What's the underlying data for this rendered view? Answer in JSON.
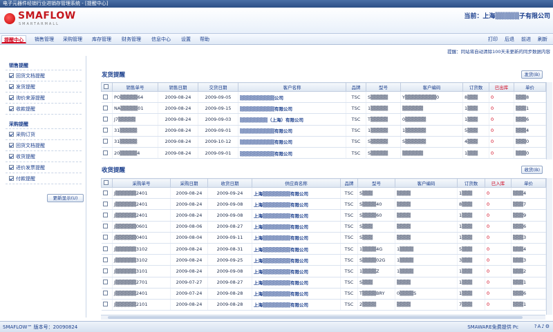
{
  "window": {
    "title": "电子元器件经销行业进销存管理系统 - [提醒中心]"
  },
  "header": {
    "logo_text": "SMAFLOW",
    "logo_sub": "SMARTARMALL",
    "company": "当前：上海▒▒▒▒▒子有限公司"
  },
  "menu": {
    "items": [
      "提醒中心",
      "销售管理",
      "采购管理",
      "库存管理",
      "财务管理",
      "信息中心",
      "设置",
      "帮助"
    ],
    "toolbar": [
      "打印",
      "后退",
      "前进",
      "刷新"
    ]
  },
  "notice": "提醒：同站将自动清除100天未更新的同步数据内容",
  "sidebar": {
    "sales_group": "销售提醒",
    "sales_items": [
      "回货文档提醒",
      "发货提醒",
      "询价来源提醒",
      "收款提醒"
    ],
    "purchase_group": "采购提醒",
    "purchase_items": [
      "采购订货",
      "回货文档提醒",
      "收货提醒",
      "进价发票提醒",
      "付款提醒"
    ],
    "more_button": "更新显示(U)"
  },
  "ship": {
    "title": "发货提醒",
    "button": "发货(B)",
    "headers": [
      "",
      "销售单号",
      "销售日期",
      "交货日期",
      "客户名称",
      "品牌",
      "型号",
      "客户编码",
      "订货数",
      "已出库",
      "单价"
    ],
    "rows": [
      [
        "",
        "PO▒▒▒▒▒64",
        "2009-08-24",
        "2009-09-05",
        "▒▒▒▒▒▒▒▒▒▒公司",
        "TSC",
        "S▒▒▒▒▒",
        "Y▒▒▒▒▒▒▒▒▒0",
        "8▒▒▒",
        "0",
        "▒▒▒8"
      ],
      [
        "",
        "NA▒▒▒▒▒01",
        "2009-08-24",
        "2009-09-15",
        "▒▒▒▒▒▒▒▒▒▒有限公司",
        "TSC",
        "1▒▒▒▒▒",
        "▒▒▒▒▒▒",
        "1▒▒▒",
        "0",
        "▒▒▒1"
      ],
      [
        "",
        "J7▒▒▒▒▒",
        "2009-08-24",
        "2009-09-03",
        "▒▒▒▒▒▒▒▒（上海）有限公司",
        "TSC",
        "T▒▒▒▒▒",
        "0▒▒▒▒▒▒",
        "1▒▒▒",
        "0",
        "▒▒▒6"
      ],
      [
        "",
        "31▒▒▒▒▒",
        "2009-08-24",
        "2009-09-01",
        "▒▒▒▒▒▒▒▒▒▒有限公司",
        "TSC",
        "1▒▒▒▒▒",
        "1▒▒▒▒▒▒",
        "5▒▒▒",
        "0",
        "▒▒▒4"
      ],
      [
        "",
        "31▒▒▒▒▒",
        "2009-08-24",
        "2009-10-12",
        "▒▒▒▒▒▒▒▒▒▒有限公司",
        "TSC",
        "S▒▒▒▒▒",
        "S▒▒▒▒▒▒",
        "4▒▒▒",
        "0",
        "▒▒▒0"
      ],
      [
        "",
        "20▒▒▒▒▒4",
        "2009-08-24",
        "2009-09-01",
        "▒▒▒▒▒▒▒▒▒▒有限公司",
        "TSC",
        "S▒▒▒▒▒",
        "▒▒▒▒▒▒",
        "1▒▒▒",
        "0",
        "▒▒▒0"
      ]
    ]
  },
  "receive": {
    "title": "收货提醒",
    "button": "收货(B)",
    "headers": [
      "",
      "采购单号",
      "采购日期",
      "收货日期",
      "供应商名称",
      "品牌",
      "型号",
      "客户编码",
      "订货数",
      "已入库",
      "单价"
    ],
    "rows": [
      [
        "",
        "J▒▒▒▒▒▒2401",
        "2009-08-24",
        "2009-09-24",
        "上海▒▒▒▒▒▒▒▒有限公司",
        "TSC",
        "S▒▒▒",
        "▒▒▒▒",
        "1▒▒▒",
        "0",
        "▒▒▒4"
      ],
      [
        "",
        "J▒▒▒▒▒▒2401",
        "2009-08-24",
        "2009-09-08",
        "上海▒▒▒▒▒▒▒▒有限公司",
        "TSC",
        "S▒▒▒▒40",
        "▒▒▒▒",
        "8▒▒▒",
        "0",
        "▒▒▒7"
      ],
      [
        "",
        "J▒▒▒▒▒▒2401",
        "2009-08-24",
        "2009-09-08",
        "上海▒▒▒▒▒▒▒▒有限公司",
        "TSC",
        "S▒▒▒▒60",
        "▒▒▒▒",
        "1▒▒▒",
        "0",
        "▒▒▒9"
      ],
      [
        "",
        "J▒▒▒▒▒▒0601",
        "2009-08-06",
        "2009-08-27",
        "上海▒▒▒▒▒▒▒▒有限公司",
        "TSC",
        "S▒▒▒",
        "▒▒▒▒",
        "1▒▒▒",
        "0",
        "▒▒▒6"
      ],
      [
        "",
        "J▒▒▒▒▒▒0401",
        "2009-08-04",
        "2009-09-11",
        "上海▒▒▒▒▒▒▒▒有限公司",
        "TSC",
        "S▒▒▒",
        "▒▒▒▒",
        "1▒▒▒",
        "0",
        "▒▒▒3"
      ],
      [
        "",
        "J▒▒▒▒▒▒3102",
        "2009-08-24",
        "2009-08-31",
        "上海▒▒▒▒▒▒▒▒有限公司",
        "TSC",
        "1▒▒▒▒4G",
        "1▒▒▒▒",
        "5▒▒▒",
        "0",
        "▒▒▒4"
      ],
      [
        "",
        "J▒▒▒▒▒▒3102",
        "2009-08-24",
        "2009-09-25",
        "上海▒▒▒▒▒▒▒▒有限公司",
        "TSC",
        "S▒▒▒▒02G",
        "1▒▒▒▒",
        "3▒▒▒",
        "0",
        "▒▒▒3"
      ],
      [
        "",
        "J▒▒▒▒▒▒3101",
        "2009-08-24",
        "2009-09-08",
        "上海▒▒▒▒▒▒▒▒有限公司",
        "TSC",
        "1▒▒▒▒Z",
        "1▒▒▒▒",
        "1▒▒▒",
        "0",
        "▒▒▒2"
      ],
      [
        "",
        "J▒▒▒▒▒▒2701",
        "2009-07-27",
        "2009-08-27",
        "上海▒▒▒▒▒▒▒▒有限公司",
        "TSC",
        "S▒▒▒",
        "▒▒▒▒",
        "1▒▒▒",
        "0",
        "▒▒▒1"
      ],
      [
        "",
        "J▒▒▒▒▒▒2401",
        "2009-07-24",
        "2009-08-28",
        "上海▒▒▒▒▒▒▒▒有限公司",
        "TSC",
        "T▒▒▒▒BRY",
        "0▒▒▒▒S",
        "1▒▒▒",
        "0",
        "▒▒▒6"
      ],
      [
        "",
        "J▒▒▒▒▒▒2101",
        "2009-08-24",
        "2009-08-28",
        "上海▒▒▒▒▒▒▒▒有限公司",
        "TSC",
        "2▒▒▒▒",
        "▒▒▒▒",
        "7▒▒▒",
        "0",
        "▒▒▒1"
      ]
    ]
  },
  "status": {
    "left": "SMAFLOW™ 版本号：20090824",
    "right": "SMAWARE免费提供 Pc"
  }
}
